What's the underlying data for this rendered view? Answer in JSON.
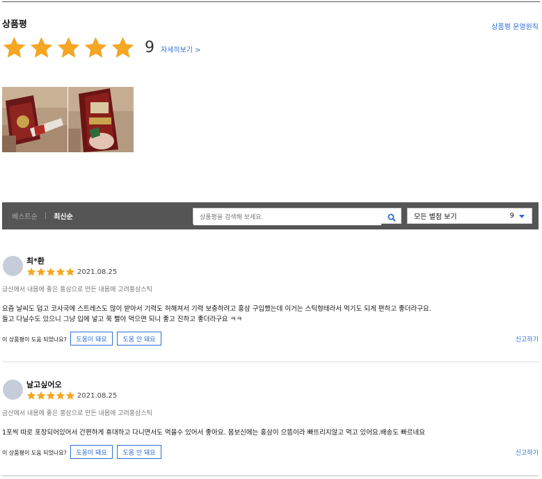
{
  "header": {
    "title": "상품평",
    "policy_link": "상품평 운영원칙",
    "review_count": "9",
    "detail_link": "자세히보기 >",
    "rating": 5,
    "star_color": "#f5a623"
  },
  "toolbar": {
    "sort_best": "베스트순",
    "sort_separator": "|",
    "sort_latest": "최신순",
    "search_placeholder": "상품평을 검색해 보세요.",
    "filter_label": "모든 별점 보기",
    "filter_count": "9"
  },
  "reviews": [
    {
      "name": "최*환",
      "rating": 5,
      "date": "2021.08.25",
      "product": "금산에서 내몸에 좋은 홍삼으로 만든 내몸애 고려홍삼스틱",
      "body_line1": "요즘 날씨도 덥고 코사국에 스트레스도 많이 받아서 기력도 허해져서 기력 보충하려고 홍삼 구입했는데 이거는 스틱형태라서 먹기도 되게 편하고 좋더라구요.",
      "body_line2": "들고 다닐수도 있으니 그냥 입에 넣고 쭉 빨아 먹으면 되니 좋고 진하고 좋더라구요 ㅋㅋ",
      "helpful_q": "이 상품평이 도움 되었나요?",
      "helpful_yes": "도움이 돼요",
      "helpful_no": "도움 안 돼요",
      "report": "신고하기"
    },
    {
      "name": "날고싶어오",
      "rating": 5,
      "date": "2021.08.25",
      "product": "금산에서 내몸에 좋은 홍삼으로 만든 내몸애 고려홍삼스틱",
      "body_line1": "1포씩 따로 포장되어있어서 간편하게 휴대하고 다니면서도 먹을수 있어서 좋아요. 몸보신에는 홍삼이 으뜸이라 빠뜨리지않고 먹고 있어요.배송도 빠르네요",
      "body_line2": "",
      "helpful_q": "이 상품평이 도움 되었나요?",
      "helpful_yes": "도움이 돼요",
      "helpful_no": "도움 안 돼요",
      "report": "신고하기"
    }
  ]
}
